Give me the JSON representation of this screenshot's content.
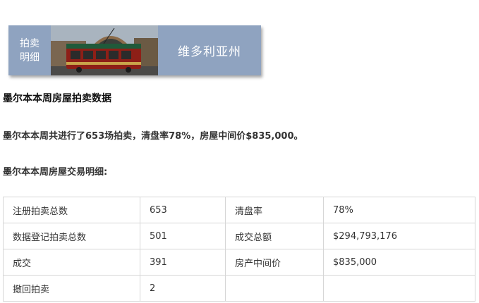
{
  "banner": {
    "tag_line1": "拍卖",
    "tag_line2": "明细",
    "title": "维多利亚州",
    "colors": {
      "background": "#8fa3c0",
      "text": "#ffffff"
    }
  },
  "heading": "墨尔本本周房屋拍卖数据",
  "summary": "墨尔本本周共进行了653场拍卖，清盘率78%，房屋中间价$835,000。",
  "subheading": "墨尔本本周房屋交易明细:",
  "table": {
    "rows": [
      [
        "注册拍卖总数",
        "653",
        "清盘率",
        "78%"
      ],
      [
        "数据登记拍卖总数",
        "501",
        "成交总额",
        "$294,793,176"
      ],
      [
        "成交",
        "391",
        "房产中间价",
        "$835,000"
      ],
      [
        "撤回拍卖",
        "2",
        "",
        ""
      ]
    ]
  }
}
